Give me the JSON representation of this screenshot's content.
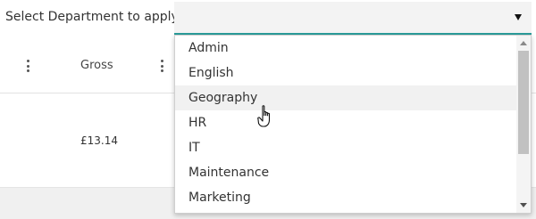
{
  "apply_bar": {
    "label": "Select Department to apply:",
    "selected_value": ""
  },
  "table": {
    "headers": {
      "gross": "Gross"
    },
    "rows": [
      {
        "gross": "£13.14"
      }
    ]
  },
  "department_dropdown": {
    "options": [
      "Admin",
      "English",
      "Geography",
      "HR",
      "IT",
      "Maintenance",
      "Marketing"
    ],
    "hovered_option": "Geography"
  },
  "icons": {
    "select_arrow": "triangle-down-icon",
    "column_menu": "kebab-menu-icon",
    "cursor": "hand-pointer-cursor"
  },
  "colors": {
    "accent_underline": "#2a9d9b",
    "hover_background": "#f1f1f1"
  }
}
